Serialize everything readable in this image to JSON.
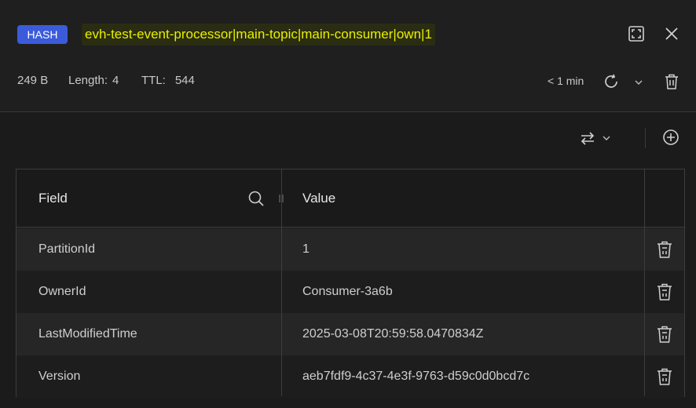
{
  "header": {
    "type_badge": "HASH",
    "key_name": "evh-test-event-processor|main-topic|main-consumer|own|1",
    "size": "249 B",
    "length_label": "Length:",
    "length_value": "4",
    "ttl_label": "TTL:",
    "ttl_value": "544",
    "refresh_label": "< 1 min",
    "icons": [
      "fullscreen-icon",
      "close-icon",
      "refresh-icon",
      "chevron-down-icon",
      "trash-icon"
    ]
  },
  "toolbar": {
    "icons": [
      "swap-icon",
      "chevron-down-icon",
      "add-circle-icon"
    ]
  },
  "table": {
    "columns": [
      "Field",
      "Value"
    ],
    "rows": [
      {
        "field": "PartitionId",
        "value": "1"
      },
      {
        "field": "OwnerId",
        "value": "Consumer-3a6b"
      },
      {
        "field": "LastModifiedTime",
        "value": "2025-03-08T20:59:58.0470834Z"
      },
      {
        "field": "Version",
        "value": "aeb7fdf9-4c37-4e3f-9763-d59c0d0bcd7c"
      }
    ]
  },
  "colors": {
    "badge_bg": "#3b5bdb",
    "key_highlight": "#e8f000",
    "background": "#1b1b1b"
  }
}
